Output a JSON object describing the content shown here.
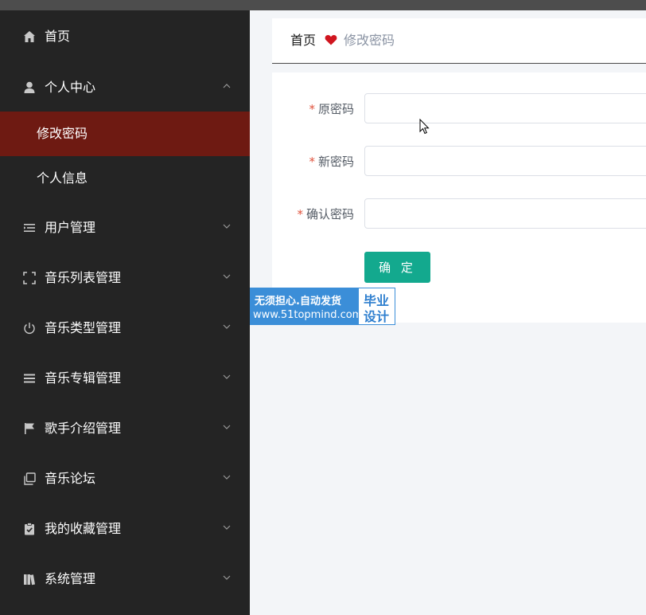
{
  "sidebar": {
    "items": [
      {
        "label": "首页",
        "icon": "home-icon"
      },
      {
        "label": "个人中心",
        "icon": "user-icon",
        "expanded": true,
        "children": [
          {
            "label": "修改密码",
            "active": true
          },
          {
            "label": "个人信息",
            "active": false
          }
        ]
      },
      {
        "label": "用户管理",
        "icon": "list-icon"
      },
      {
        "label": "音乐列表管理",
        "icon": "fullscreen-icon"
      },
      {
        "label": "音乐类型管理",
        "icon": "power-icon"
      },
      {
        "label": "音乐专辑管理",
        "icon": "menu-icon"
      },
      {
        "label": "歌手介绍管理",
        "icon": "flag-icon"
      },
      {
        "label": "音乐论坛",
        "icon": "copy-icon"
      },
      {
        "label": "我的收藏管理",
        "icon": "clipboard-check-icon"
      },
      {
        "label": "系统管理",
        "icon": "books-icon"
      }
    ]
  },
  "breadcrumb": {
    "home": "首页",
    "current": "修改密码"
  },
  "form": {
    "required_mark": "*",
    "old_password": {
      "label": "原密码",
      "value": ""
    },
    "new_password": {
      "label": "新密码",
      "value": ""
    },
    "confirm_password": {
      "label": "确认密码",
      "value": ""
    },
    "submit_label": "确 定"
  },
  "watermark": {
    "line1": "无须担心.自动发货",
    "line2": "www.51topmind.com",
    "badge1": "毕业",
    "badge2": "设计"
  },
  "colors": {
    "sidebar_bg": "#242424",
    "active_item_bg": "#6e1a12",
    "primary": "#13a98e",
    "heart": "#d0151f"
  }
}
